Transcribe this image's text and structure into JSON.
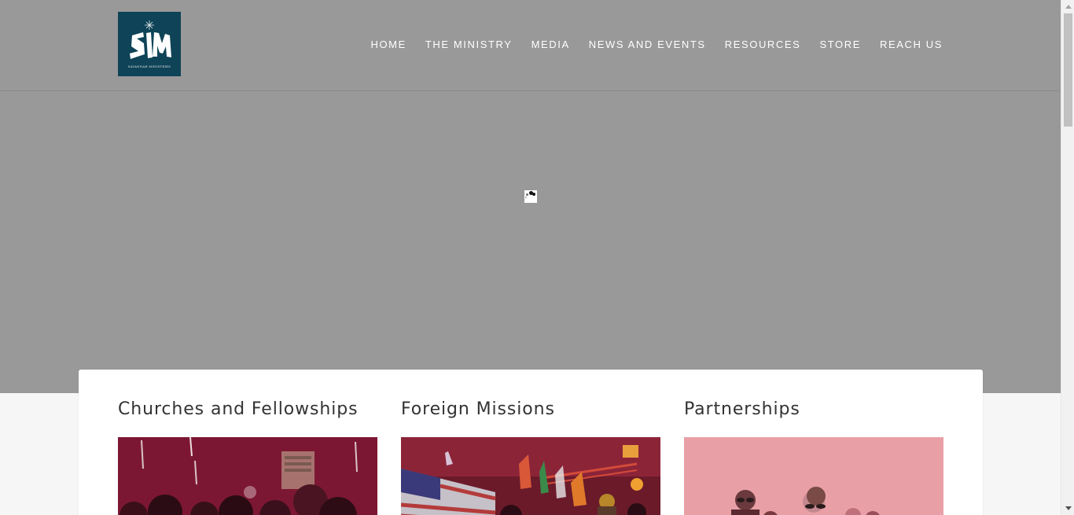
{
  "brand": {
    "logo_letters": "SIM",
    "logo_subtitle": "SAVANNAH MINISTRIES",
    "logo_bg": "#0f4357"
  },
  "nav": [
    {
      "label": "HOME"
    },
    {
      "label": "THE MINISTRY"
    },
    {
      "label": "MEDIA"
    },
    {
      "label": "NEWS AND EVENTS"
    },
    {
      "label": "RESOURCES"
    },
    {
      "label": "STORE"
    },
    {
      "label": "REACH US"
    }
  ],
  "hero": {
    "background": "#999999",
    "loader_icon": "loading-spinner-icon"
  },
  "sections": [
    {
      "title": "Churches and Fellowships",
      "image": "worship-crowd-photo"
    },
    {
      "title": "Foreign Missions",
      "image": "flags-concert-photo"
    },
    {
      "title": "Partnerships",
      "image": "people-group-photo"
    }
  ],
  "colors": {
    "overlay": "#8b1538",
    "header_text": "#ffffff",
    "heading_text": "#333333"
  }
}
